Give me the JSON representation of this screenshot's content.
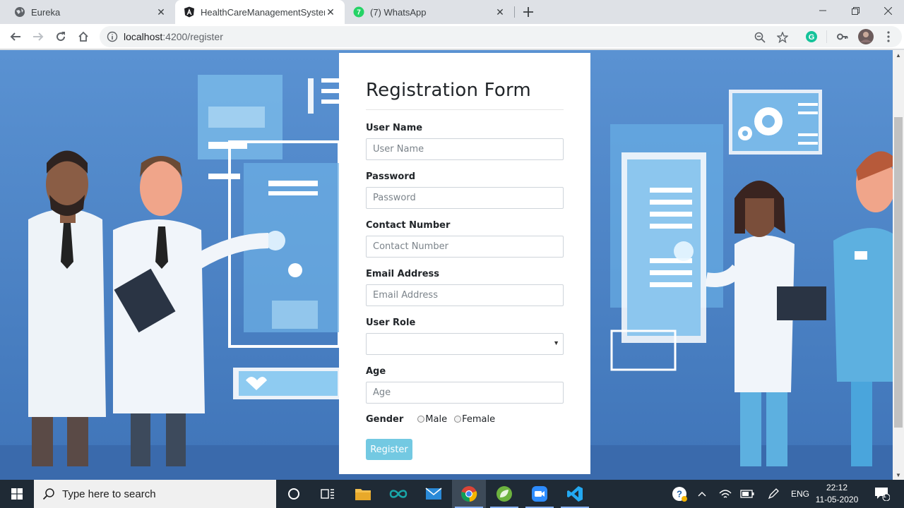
{
  "browser": {
    "tabs": [
      {
        "label": "Eureka",
        "icon": "globe-icon"
      },
      {
        "label": "HealthCareManagementSystem",
        "icon": "angular-icon"
      },
      {
        "label": "(7) WhatsApp",
        "icon": "whatsapp-icon"
      }
    ],
    "url_host": "localhost",
    "url_path": ":4200/register"
  },
  "form": {
    "title": "Registration Form",
    "username": {
      "label": "User Name",
      "placeholder": "User Name"
    },
    "password": {
      "label": "Password",
      "placeholder": "Password"
    },
    "contact": {
      "label": "Contact Number",
      "placeholder": "Contact Number"
    },
    "email": {
      "label": "Email Address",
      "placeholder": "Email Address"
    },
    "role": {
      "label": "User Role",
      "value": ""
    },
    "age": {
      "label": "Age",
      "placeholder": "Age"
    },
    "gender": {
      "label": "Gender",
      "options": [
        "Male",
        "Female"
      ]
    },
    "submit_label": "Register",
    "submit_color": "#5bc0de"
  },
  "taskbar": {
    "search_placeholder": "Type here to search",
    "language": "ENG",
    "time": "22:12",
    "date": "11-05-2020",
    "notification_count": "1"
  }
}
